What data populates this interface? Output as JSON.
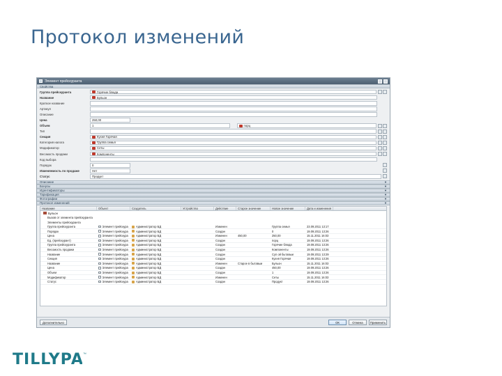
{
  "slide": {
    "title": "Протокол изменений"
  },
  "window": {
    "title": "Элемент прейскуранта",
    "section_main": "Свойства"
  },
  "form": {
    "rows": [
      {
        "label": "Группа прейскуранта",
        "value": "Горячие блюда",
        "bold": true,
        "icon": true,
        "btns": 2
      },
      {
        "label": "Название",
        "value": "Бульон",
        "bold": true,
        "icon": true,
        "btns": 0
      },
      {
        "label": "Краткое название",
        "value": "",
        "bold": false,
        "icon": false,
        "btns": 0
      },
      {
        "label": "Артикул",
        "value": "",
        "bold": false,
        "icon": false,
        "btns": 0
      },
      {
        "label": "Описание",
        "value": "",
        "bold": false,
        "icon": false,
        "btns": 0
      },
      {
        "label": "Цена",
        "value": "250,00",
        "bold": true,
        "icon": false,
        "btns": 0,
        "short": true
      },
      {
        "label": "Объем",
        "value": "1",
        "bold": true,
        "icon": false,
        "btns": 2,
        "unit": "порц"
      },
      {
        "label": "Тип",
        "value": "",
        "bold": false,
        "icon": false,
        "btns": 2
      },
      {
        "label": "Секция",
        "value": "Кухня Горячая",
        "bold": true,
        "icon": true,
        "btns": 2
      },
      {
        "label": "Категория налога",
        "value": "Группа семья",
        "bold": false,
        "icon": true,
        "btns": 2
      },
      {
        "label": "Модификатор",
        "value": "Сеты",
        "bold": false,
        "icon": true,
        "btns": 2
      },
      {
        "label": "Весомость продажи",
        "value": "Компоненты",
        "bold": false,
        "icon": true,
        "btns": 2
      },
      {
        "label": "Код выбора",
        "value": "",
        "bold": false,
        "icon": false,
        "btns": 0
      },
      {
        "label": "Порядок",
        "value": "0",
        "bold": false,
        "icon": false,
        "btns": 1,
        "short": true
      },
      {
        "label": "Изменяемость по продаже",
        "value": "Нет",
        "bold": true,
        "icon": false,
        "btns": 1,
        "short": true
      },
      {
        "label": "Статус",
        "value": "Продукт",
        "bold": true,
        "icon": false,
        "btns": 1
      }
    ]
  },
  "collapsed_sections": [
    "Описание",
    "Бонусы",
    "Идентификаторы",
    "Тарификация",
    "Фотографии",
    "Протокол изменений"
  ],
  "log": {
    "columns": [
      "Название",
      "Объект",
      "Создатель",
      "Устройство",
      "Действие",
      "Старое значение",
      "Новое значение",
      "Дата и изменения"
    ],
    "tree": [
      "Бульон",
      "Вызов от элемента прейскуранта",
      "Элементы прейскуранта"
    ],
    "rows": [
      [
        "Группа прейскуранта",
        "Элемент прейскура",
        "Администратор БД",
        "",
        "Изменен",
        "",
        "Группа семья",
        "23.09.2011 13:17"
      ],
      [
        "Порядок",
        "Элемент прейскура",
        "Администратор БД",
        "",
        "Создан",
        "",
        "0",
        "19.09.2011 13:26"
      ],
      [
        "Цена",
        "Элемент прейскура",
        "Администратор БД",
        "",
        "Изменен",
        "450,00",
        "250,00",
        "15.11.2011 16:03"
      ],
      [
        "Ед. (прейскурант)",
        "Элемент прейскура",
        "Администратор БД",
        "",
        "Создан",
        "",
        "порц",
        "19.09.2011 13:26"
      ],
      [
        "Группа прейскуранта",
        "Элемент прейскура",
        "Администратор БД",
        "",
        "Создан",
        "",
        "Горячие блюда",
        "19.09.2011 13:26"
      ],
      [
        "Весомость продажи",
        "Элемент прейскура",
        "Администратор БД",
        "",
        "Создан",
        "",
        "Компоненты",
        "19.09.2011 13:26"
      ],
      [
        "Название",
        "Элемент прейскура",
        "Администратор БД",
        "",
        "Создан",
        "",
        "Суп ой бытавыи",
        "19.09.2011 13:29"
      ],
      [
        "Секция",
        "Элемент прейскура",
        "Администратор БД",
        "",
        "Создан",
        "",
        "Кухня Горячая",
        "19.09.2011 13:26"
      ],
      [
        "Название",
        "Элемент прейскура",
        "Администратор БД",
        "",
        "Изменен",
        "Старое в бытавыи",
        "Бульон",
        "15.11.2011 16:03"
      ],
      [
        "Цена",
        "Элемент прейскура",
        "Администратор БД",
        "",
        "Создан",
        "",
        "450,00",
        "19.09.2011 13:26"
      ],
      [
        "Объем",
        "Элемент прейскура",
        "Администратор БД",
        "",
        "Создан",
        "",
        "1",
        "19.09.2011 13:26"
      ],
      [
        "Модификатор",
        "Элемент прейскура",
        "Администратор БД",
        "",
        "Изменен",
        "",
        "Сеты",
        "15.11.2011 16:03"
      ],
      [
        "Статус",
        "Элемент прейскура",
        "Администратор БД",
        "",
        "Создан",
        "",
        "Продукт",
        "19.09.2011 13:26"
      ]
    ]
  },
  "footer": {
    "left": "Дополнительно",
    "ok": "ОК",
    "cancel": "Отмена",
    "apply": "Применить"
  },
  "logo": {
    "text": "TILLYPAD",
    "tm": "™",
    "color": "#1f7a89"
  }
}
